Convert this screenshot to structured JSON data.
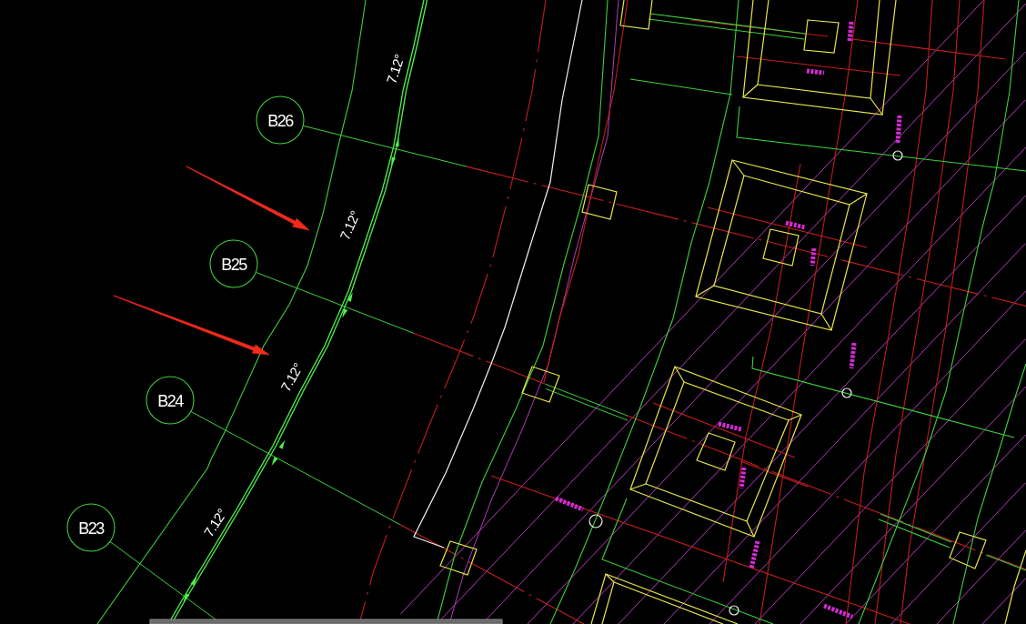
{
  "drawing": {
    "axes": [
      {
        "label": "B26"
      },
      {
        "label": "B25"
      },
      {
        "label": "B24"
      },
      {
        "label": "B23"
      }
    ],
    "angle_dimensions": [
      {
        "text": "7.12°"
      },
      {
        "text": "7.12°"
      },
      {
        "text": "7.12°"
      },
      {
        "text": "7.12°"
      }
    ]
  }
}
